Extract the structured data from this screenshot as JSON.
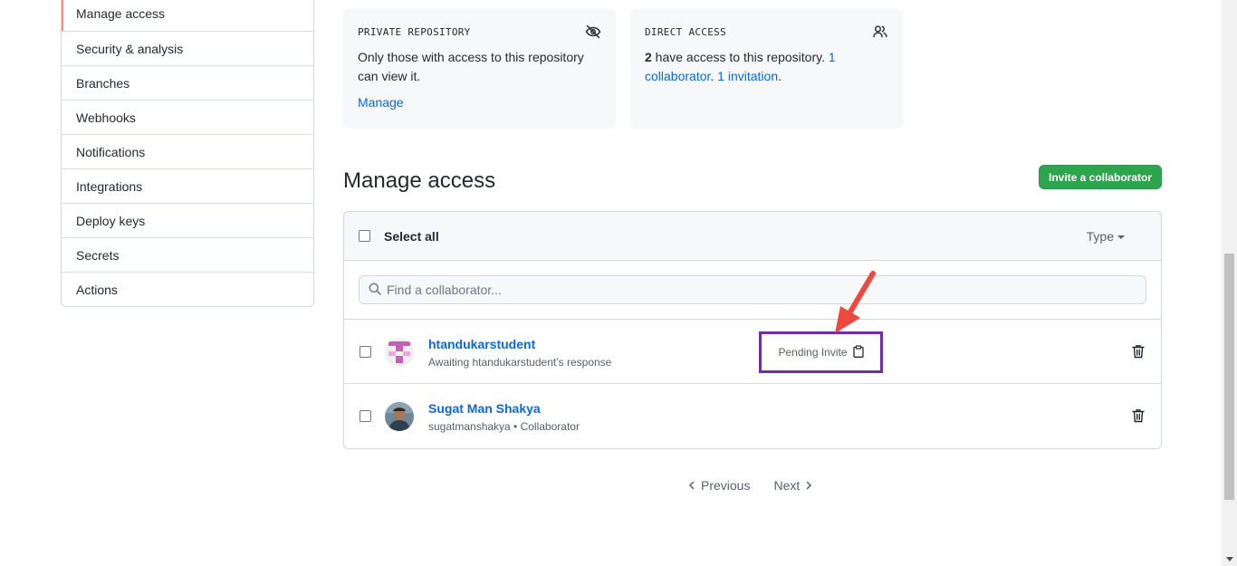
{
  "sidebar": {
    "items": [
      {
        "label": "Manage access",
        "active": true
      },
      {
        "label": "Security & analysis"
      },
      {
        "label": "Branches"
      },
      {
        "label": "Webhooks"
      },
      {
        "label": "Notifications"
      },
      {
        "label": "Integrations"
      },
      {
        "label": "Deploy keys"
      },
      {
        "label": "Secrets"
      },
      {
        "label": "Actions"
      }
    ]
  },
  "cards": {
    "private": {
      "title": "PRIVATE REPOSITORY",
      "icon": "eye-closed-icon",
      "text": "Only those with access to this repository can view it.",
      "link": "Manage"
    },
    "direct": {
      "title": "DIRECT ACCESS",
      "icon": "people-icon",
      "count": "2",
      "text_mid": " have access to this repository. ",
      "collab_link": "1 collaborator",
      "sep": ". ",
      "invite_link": "1 invitation",
      "end": "."
    }
  },
  "manage": {
    "title": "Manage access",
    "invite_button": "Invite a collaborator",
    "select_all": "Select all",
    "type_filter": "Type",
    "search_placeholder": "Find a collaborator...",
    "rows": [
      {
        "name": "htandukarstudent",
        "sub": "Awaiting htandukarstudent’s response",
        "badge": "Pending Invite"
      },
      {
        "name": "Sugat Man Shakya",
        "sub": "sugatmanshakya • Collaborator"
      }
    ]
  },
  "pager": {
    "previous": "Previous",
    "next": "Next"
  },
  "colors": {
    "accent": "#0969da",
    "invite_green": "#2da44e",
    "annotation_arrow": "#f0483e",
    "highlight_box": "#6f2da8"
  }
}
